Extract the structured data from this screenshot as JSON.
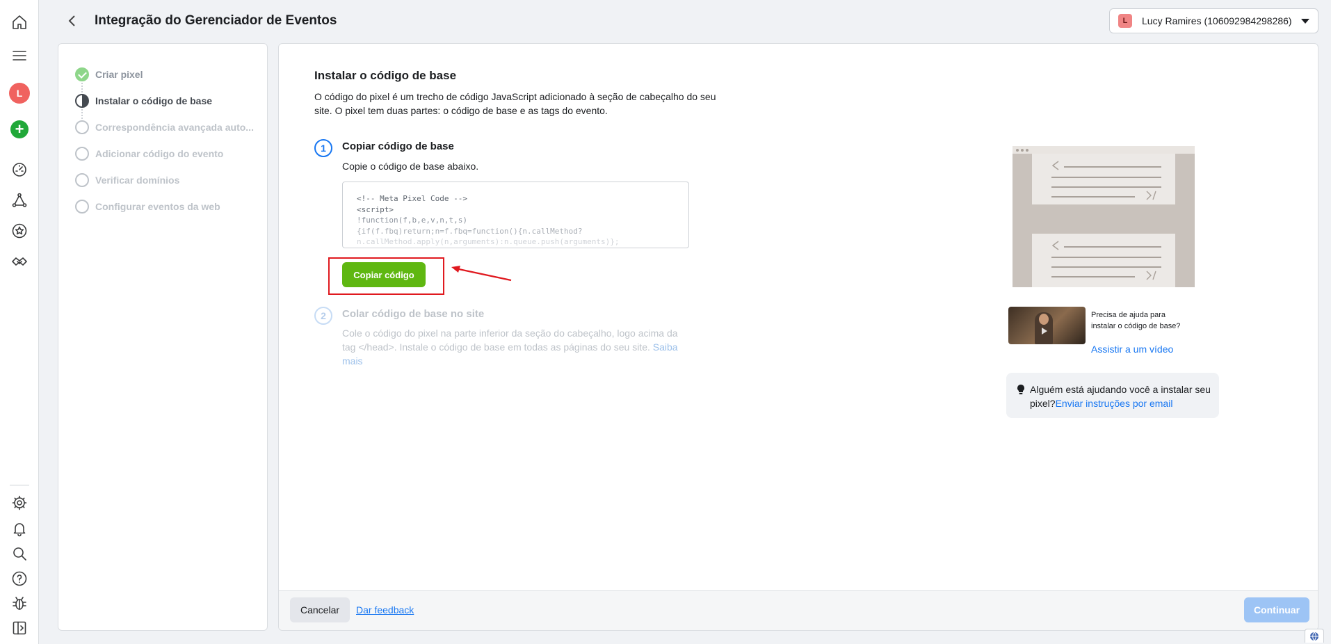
{
  "header": {
    "title": "Integração do Gerenciador de Eventos",
    "account": {
      "initial": "L",
      "label": "Lucy Ramires (106092984298286)"
    }
  },
  "rail": {
    "avatar_initial": "L",
    "plus": "+",
    "icons": [
      "home-icon",
      "menu-icon",
      "avatar",
      "add-icon",
      "dashboard-icon",
      "network-icon",
      "star-icon",
      "handshake-icon",
      "gear-icon",
      "bell-icon",
      "search-icon",
      "help-icon",
      "bug-icon",
      "sidebar-toggle-icon"
    ]
  },
  "steps": [
    {
      "label": "Criar pixel",
      "state": "done"
    },
    {
      "label": "Instalar o código de base",
      "state": "current"
    },
    {
      "label": "Correspondência avançada auto...",
      "state": "pending"
    },
    {
      "label": "Adicionar código do evento",
      "state": "pending"
    },
    {
      "label": "Verificar domínios",
      "state": "pending"
    },
    {
      "label": "Configurar eventos da web",
      "state": "pending"
    }
  ],
  "main": {
    "title": "Instalar o código de base",
    "description": "O código do pixel é um trecho de código JavaScript adicionado à seção de cabeçalho do seu site. O pixel tem duas partes: o código de base e as tags do evento.",
    "step1": {
      "number": "1",
      "title": "Copiar código de base",
      "subtitle": "Copie o código de base abaixo.",
      "code_lines": [
        "<!-- Meta Pixel Code -->",
        "<script>",
        "!function(f,b,e,v,n,t,s)",
        "{if(f.fbq)return;n=f.fbq=function(){n.callMethod?",
        "n.callMethod.apply(n,arguments):n.queue.push(arguments)};"
      ],
      "copy_button": "Copiar código"
    },
    "step2": {
      "number": "2",
      "title": "Colar código de base no site",
      "description": "Cole o código do pixel na parte inferior da seção do cabeçalho, logo acima da tag </head>. Instale o código de base em todas as páginas do seu site.",
      "link": "Saiba mais"
    },
    "video": {
      "text": "Precisa de ajuda para instalar o código de base?",
      "link": "Assistir a um vídeo"
    },
    "help": {
      "text": "Alguém está ajudando você a instalar seu pixel?",
      "link": "Enviar instruções por email"
    }
  },
  "footer": {
    "cancel": "Cancelar",
    "feedback": "Dar feedback",
    "continue": "Continuar"
  },
  "colors": {
    "accent": "#1877f2",
    "copy_button": "#5fb711",
    "highlight": "#e0191f",
    "continue_disabled": "#9dc4f5"
  }
}
